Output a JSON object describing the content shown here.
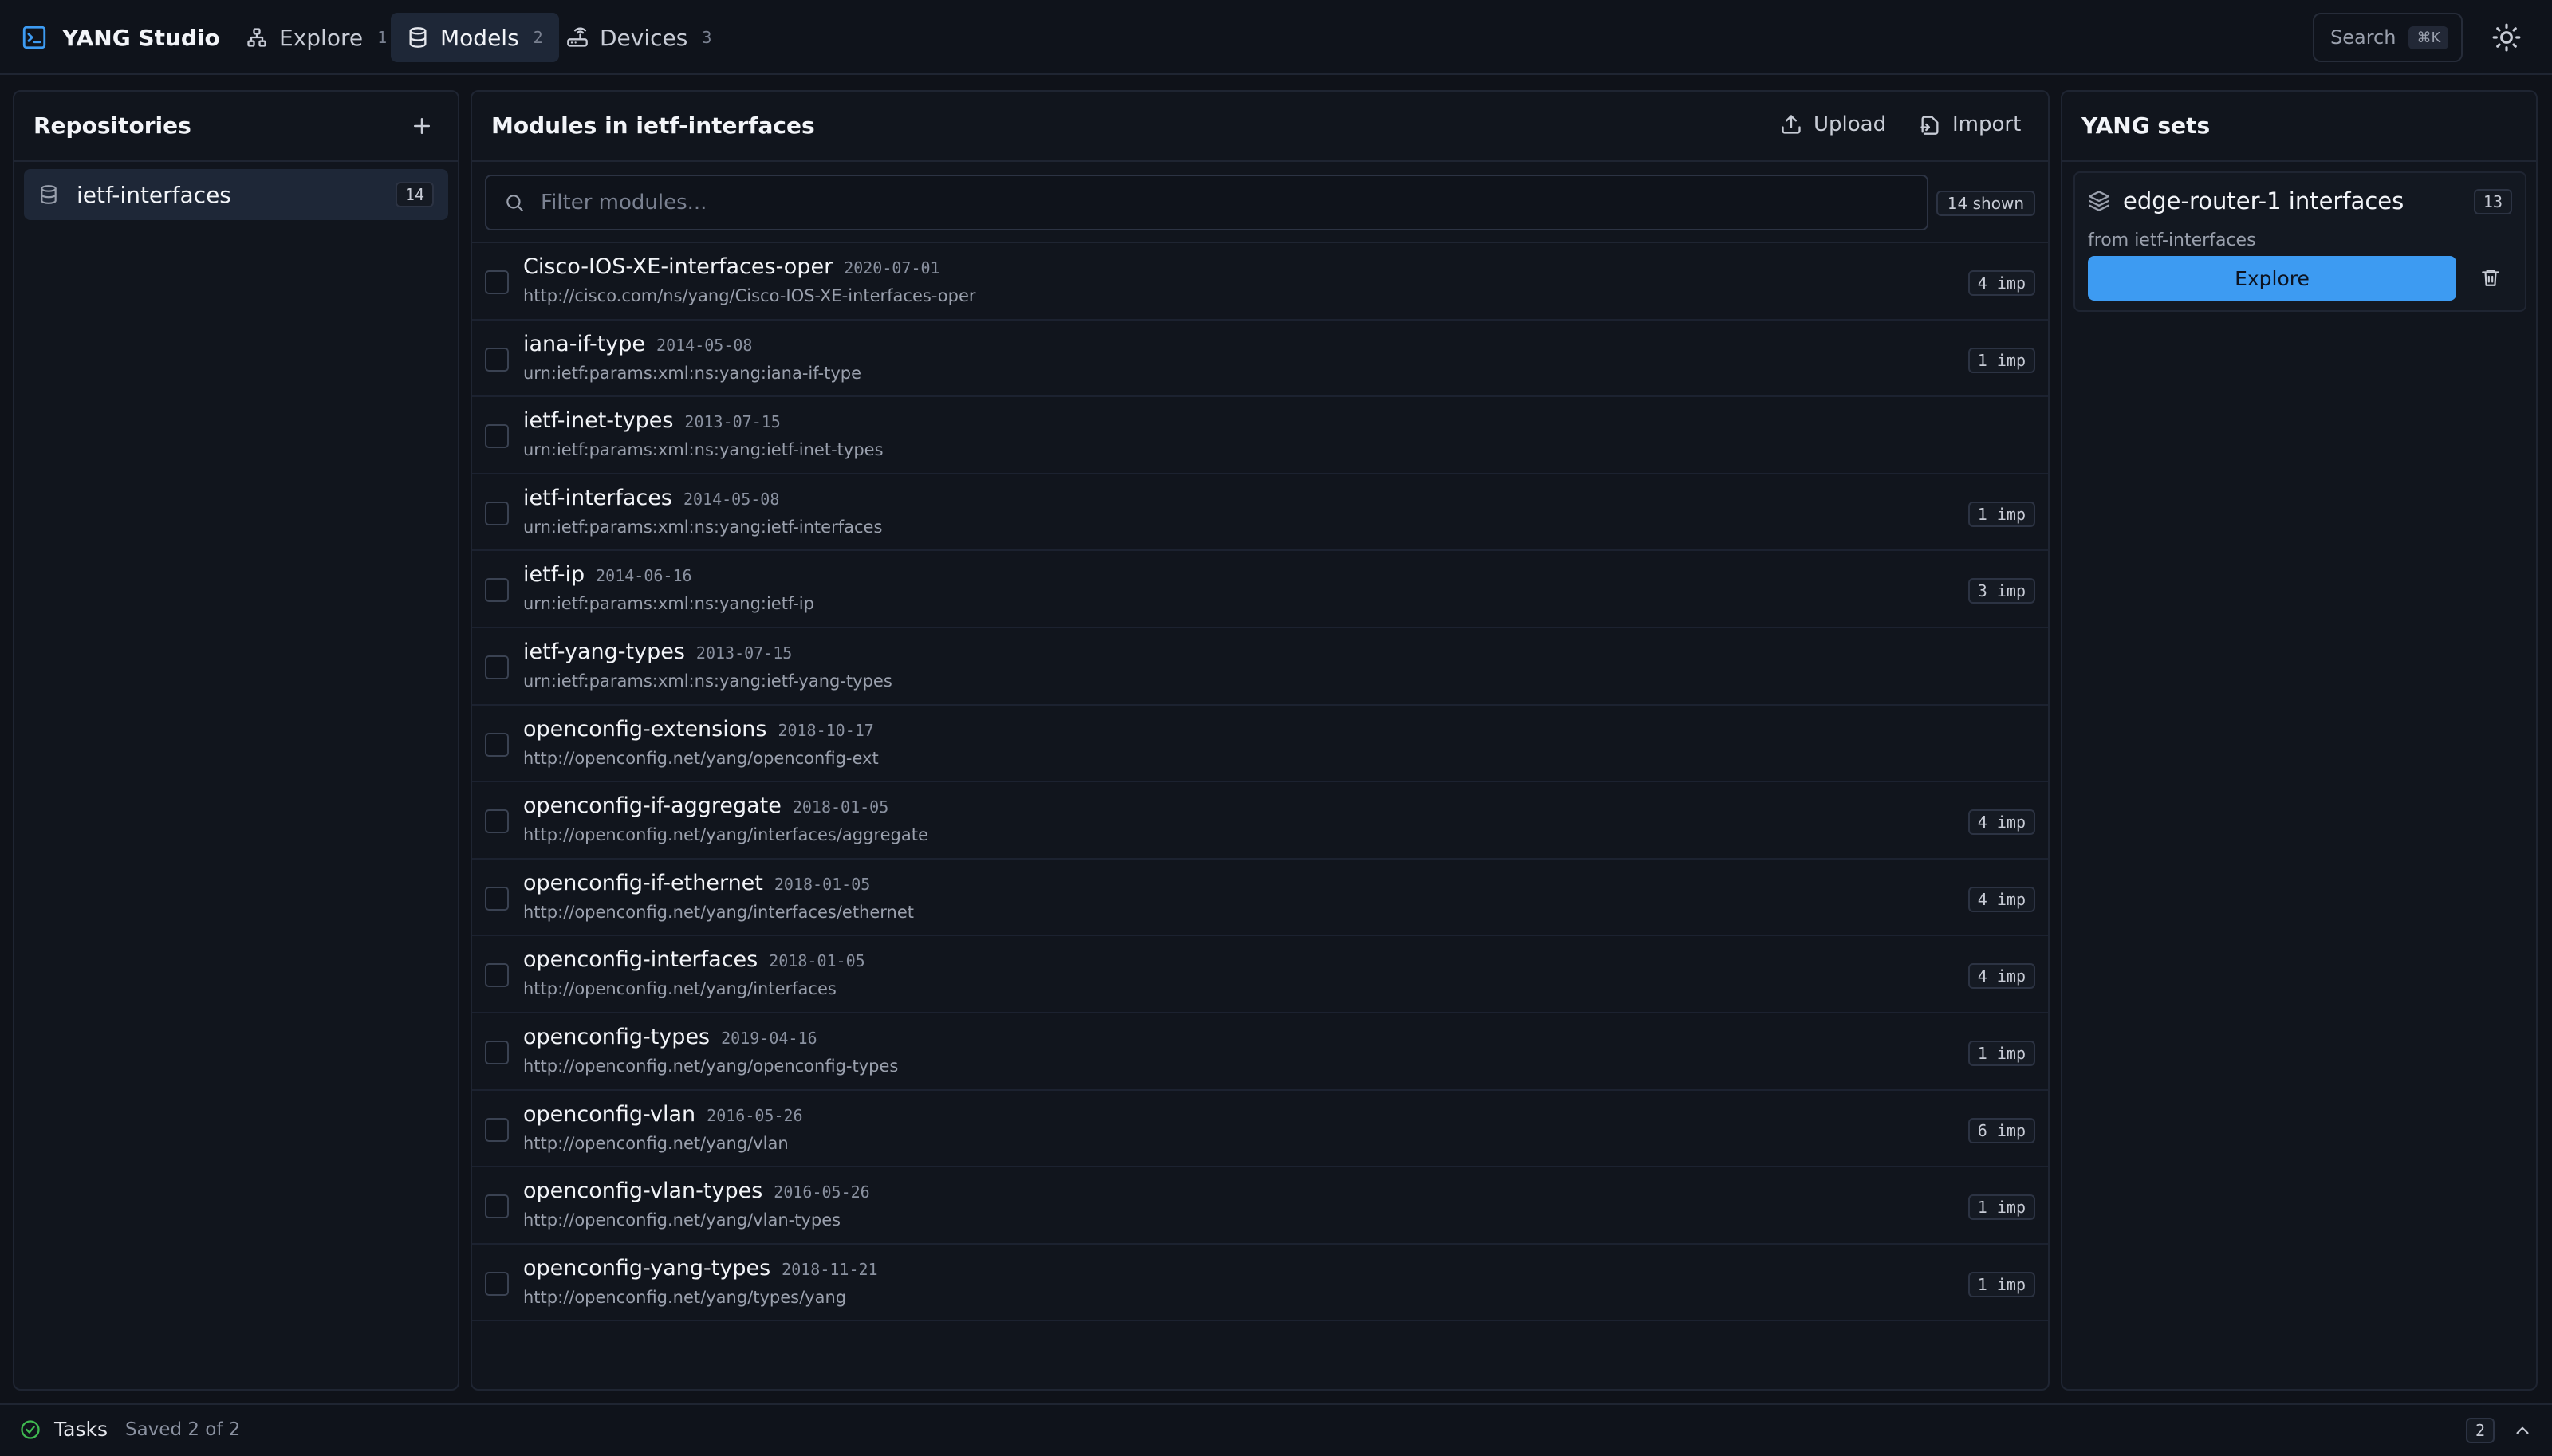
{
  "app": {
    "title": "YANG Studio"
  },
  "nav": {
    "tabs": [
      {
        "label": "Explore",
        "shortcut": "1",
        "icon": "graph-icon"
      },
      {
        "label": "Models",
        "shortcut": "2",
        "icon": "database-icon",
        "active": true
      },
      {
        "label": "Devices",
        "shortcut": "3",
        "icon": "router-icon"
      }
    ]
  },
  "search": {
    "label": "Search",
    "shortcut": "⌘K"
  },
  "repositories": {
    "title": "Repositories",
    "items": [
      {
        "name": "ietf-interfaces",
        "count": "14"
      }
    ]
  },
  "modules": {
    "title": "Modules in ietf-interfaces",
    "upload_label": "Upload",
    "import_label": "Import",
    "filter_placeholder": "Filter modules...",
    "shown": "14 shown",
    "items": [
      {
        "name": "Cisco-IOS-XE-interfaces-oper",
        "date": "2020-07-01",
        "ns": "http://cisco.com/ns/yang/Cisco-IOS-XE-interfaces-oper",
        "imports": "4 imp"
      },
      {
        "name": "iana-if-type",
        "date": "2014-05-08",
        "ns": "urn:ietf:params:xml:ns:yang:iana-if-type",
        "imports": "1 imp"
      },
      {
        "name": "ietf-inet-types",
        "date": "2013-07-15",
        "ns": "urn:ietf:params:xml:ns:yang:ietf-inet-types",
        "imports": ""
      },
      {
        "name": "ietf-interfaces",
        "date": "2014-05-08",
        "ns": "urn:ietf:params:xml:ns:yang:ietf-interfaces",
        "imports": "1 imp"
      },
      {
        "name": "ietf-ip",
        "date": "2014-06-16",
        "ns": "urn:ietf:params:xml:ns:yang:ietf-ip",
        "imports": "3 imp"
      },
      {
        "name": "ietf-yang-types",
        "date": "2013-07-15",
        "ns": "urn:ietf:params:xml:ns:yang:ietf-yang-types",
        "imports": ""
      },
      {
        "name": "openconfig-extensions",
        "date": "2018-10-17",
        "ns": "http://openconfig.net/yang/openconfig-ext",
        "imports": ""
      },
      {
        "name": "openconfig-if-aggregate",
        "date": "2018-01-05",
        "ns": "http://openconfig.net/yang/interfaces/aggregate",
        "imports": "4 imp"
      },
      {
        "name": "openconfig-if-ethernet",
        "date": "2018-01-05",
        "ns": "http://openconfig.net/yang/interfaces/ethernet",
        "imports": "4 imp"
      },
      {
        "name": "openconfig-interfaces",
        "date": "2018-01-05",
        "ns": "http://openconfig.net/yang/interfaces",
        "imports": "4 imp"
      },
      {
        "name": "openconfig-types",
        "date": "2019-04-16",
        "ns": "http://openconfig.net/yang/openconfig-types",
        "imports": "1 imp"
      },
      {
        "name": "openconfig-vlan",
        "date": "2016-05-26",
        "ns": "http://openconfig.net/yang/vlan",
        "imports": "6 imp"
      },
      {
        "name": "openconfig-vlan-types",
        "date": "2016-05-26",
        "ns": "http://openconfig.net/yang/vlan-types",
        "imports": "1 imp"
      },
      {
        "name": "openconfig-yang-types",
        "date": "2018-11-21",
        "ns": "http://openconfig.net/yang/types/yang",
        "imports": "1 imp"
      }
    ]
  },
  "yang_sets": {
    "title": "YANG sets",
    "items": [
      {
        "name": "edge-router-1 interfaces",
        "count": "13",
        "source": "from ietf-interfaces",
        "explore_label": "Explore"
      }
    ]
  },
  "status": {
    "tasks_label": "Tasks",
    "tasks_status": "Saved 2 of 2",
    "count": "2"
  },
  "colors": {
    "accent": "#3d9bf2",
    "success": "#3fb950",
    "background": "#0f1219",
    "panel": "#11151d"
  }
}
